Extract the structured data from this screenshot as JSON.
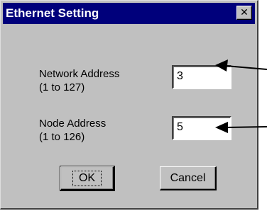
{
  "dialog": {
    "title": "Ethernet Setting",
    "close_glyph": "✕"
  },
  "fields": {
    "network": {
      "label_line1": "Network Address",
      "label_line2": "(1 to 127)",
      "value": "3"
    },
    "node": {
      "label_line1": "Node Address",
      "label_line2": "(1 to 126)",
      "value": "5"
    }
  },
  "buttons": {
    "ok_label": "OK",
    "cancel_label": "Cancel"
  },
  "colors": {
    "titlebar": "#00007b",
    "face": "#c0c0c0"
  },
  "icons": {
    "close": "close-icon",
    "callout": "arrow-left-icon"
  }
}
